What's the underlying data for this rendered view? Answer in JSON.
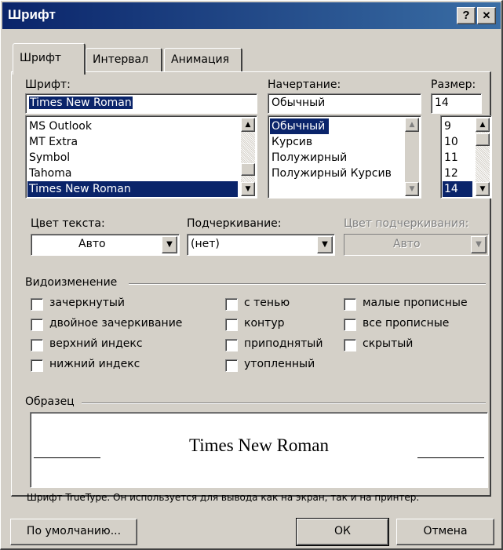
{
  "window": {
    "title": "Шрифт",
    "help_button": "?",
    "close_button": "✕"
  },
  "tabs": [
    {
      "label": "Шрифт",
      "active": true
    },
    {
      "label": "Интервал",
      "active": false
    },
    {
      "label": "Анимация",
      "active": false
    }
  ],
  "font": {
    "label": "Шрифт:",
    "value": "Times New Roman",
    "items": [
      "MS Outlook",
      "MT Extra",
      "Symbol",
      "Tahoma",
      "Times New Roman"
    ],
    "selected": "Times New Roman"
  },
  "style": {
    "label": "Начертание:",
    "value": "Обычный",
    "items": [
      "Обычный",
      "Курсив",
      "Полужирный",
      "Полужирный Курсив"
    ],
    "selected": "Обычный"
  },
  "size": {
    "label": "Размер:",
    "value": "14",
    "items": [
      "9",
      "10",
      "11",
      "12",
      "14"
    ],
    "selected": "14"
  },
  "text_color": {
    "label": "Цвет текста:",
    "value": "Авто"
  },
  "underline": {
    "label": "Подчеркивание:",
    "value": "(нет)"
  },
  "underline_color": {
    "label": "Цвет подчеркивания:",
    "value": "Авто",
    "disabled": true
  },
  "effects": {
    "label": "Видоизменение",
    "col1": [
      "зачеркнутый",
      "двойное зачеркивание",
      "верхний индекс",
      "нижний индекс"
    ],
    "col2": [
      "с тенью",
      "контур",
      "приподнятый",
      "утопленный"
    ],
    "col3": [
      "малые прописные",
      "все прописные",
      "скрытый"
    ]
  },
  "preview": {
    "label": "Образец",
    "sample_text": "Times New Roman",
    "description": "Шрифт TrueType. Он используется для вывода как на экран, так и на принтер."
  },
  "buttons": {
    "default": "По умолчанию...",
    "ok": "ОК",
    "cancel": "Отмена"
  }
}
